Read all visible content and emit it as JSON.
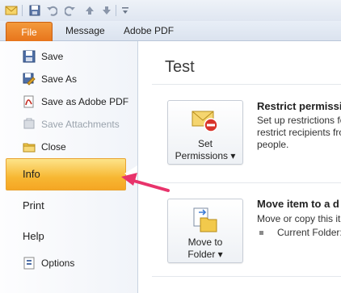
{
  "toolbar": {
    "icons": [
      "mail-icon",
      "save-icon",
      "undo-icon",
      "redo-icon",
      "up-arrow-icon",
      "down-arrow-icon",
      "customize-icon"
    ]
  },
  "ribbon": {
    "file_tab": "File",
    "tabs": [
      "Message",
      "Adobe PDF"
    ]
  },
  "menu": {
    "items": [
      {
        "label": "Save",
        "icon": "save-icon",
        "enabled": true
      },
      {
        "label": "Save As",
        "icon": "save-as-icon",
        "enabled": true
      },
      {
        "label": "Save as Adobe PDF",
        "icon": "pdf-icon",
        "enabled": true
      },
      {
        "label": "Save Attachments",
        "icon": "attachments-icon",
        "enabled": false
      },
      {
        "label": "Close",
        "icon": "folder-icon",
        "enabled": true
      }
    ],
    "info": "Info",
    "print": "Print",
    "help": "Help",
    "options": "Options"
  },
  "content": {
    "title": "Test",
    "permissions": {
      "button_line1": "Set",
      "button_line2": "Permissions ▾",
      "heading": "Restrict permissio",
      "desc_line1": "Set up restrictions fo",
      "desc_line2": "restrict recipients fro",
      "desc_line3": "people."
    },
    "move": {
      "button_line1": "Move to",
      "button_line2": "Folder ▾",
      "heading": "Move item to a d",
      "desc_line1": "Move or copy this it",
      "bullet": "Current Folder:"
    }
  },
  "colors": {
    "file_tab": "#e7731a",
    "info_highlight": "#f7b733",
    "annotation_arrow": "#e8336b"
  }
}
